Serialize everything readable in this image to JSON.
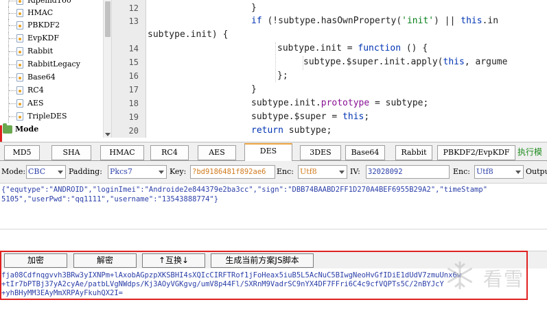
{
  "tree": {
    "items": [
      {
        "label": "Ripemd160"
      },
      {
        "label": "HMAC"
      },
      {
        "label": "PBKDF2"
      },
      {
        "label": "EvpKDF"
      },
      {
        "label": "Rabbit"
      },
      {
        "label": "RabbitLegacy"
      },
      {
        "label": "Base64"
      },
      {
        "label": "RC4"
      },
      {
        "label": "AES"
      },
      {
        "label": "TripleDES"
      }
    ],
    "group": {
      "label": "Mode"
    }
  },
  "editor": {
    "line_numbers": [
      "12",
      "13",
      "14",
      "15",
      "16",
      "17",
      "18",
      "19",
      "20"
    ],
    "lines": {
      "l12": "}",
      "l13_if": "if",
      "l13_a": " (!subtype.hasOwnProperty(",
      "l13_str": "'init'",
      "l13_b": ") || ",
      "l13_this": "this",
      "l13_c": ".in",
      "l13w": "subtype.init) {",
      "l14_a": "subtype.init = ",
      "l14_fn": "function",
      "l14_b": " () {",
      "l15_a": "subtype.$super.init.apply(",
      "l15_this": "this",
      "l15_b": ", argume",
      "l16": "};",
      "l17": "}",
      "l18_a": "subtype.init.",
      "l18_p": "prototype",
      "l18_b": " = subtype;",
      "l19_a": "subtype.$super = ",
      "l19_this": "this",
      "l19_b": ";",
      "l20_kw": "return",
      "l20_b": " subtype;"
    }
  },
  "tabs": [
    {
      "label": "MD5"
    },
    {
      "label": "SHA"
    },
    {
      "label": "HMAC"
    },
    {
      "label": "RC4"
    },
    {
      "label": "AES"
    },
    {
      "label": "DES"
    },
    {
      "label": "3DES"
    },
    {
      "label": "Base64"
    },
    {
      "label": "Rabbit"
    },
    {
      "label": "PBKDF2/EvpKDF"
    },
    {
      "label": "执行模"
    }
  ],
  "options": {
    "mode_label": "Mode:",
    "mode_value": "CBC",
    "padding_label": "Padding:",
    "padding_value": "Pkcs7",
    "key_label": "Key:",
    "key_value": "?bd9186481f892ae6",
    "key_enc_label": "Enc:",
    "key_enc_value": "Utf8",
    "iv_label": "IV:",
    "iv_value": "32028092",
    "iv_enc_label": "Enc:",
    "iv_enc_value": "Utf8",
    "output_label": "Outpu"
  },
  "input_text": {
    "line1": "{\"equtype\":\"ANDROID\",\"loginImei\":\"Androide2e844379e2ba3cc\",\"sign\":\"DBB74BAABD2FF1D270A4BEF6955B29A2\",\"timeStamp\"",
    "line2": "5105\",\"userPwd\":\"qq1111\",\"username\":\"13543888774\"}"
  },
  "buttons": {
    "encrypt": "加密",
    "decrypt": "解密",
    "swap": "↑互换↓",
    "generate": "生成当前方案JS脚本"
  },
  "output_text": {
    "line1": "fja08Cdfnqgvvh3BRw3yIXNPm+lAxobAGpzpXKSBHI4sXQIcCIRFTRof1jFoHeax5iuB5L5AcNuC5BIwgNeoHvGfIDiE1dUdV7zmuUnx6w",
    "line2": "+tIr7bPTBj37yA2cyAe/patbLVgNWdps/Kj3AOyVGKgvg/umV8p44Fl/SXRnM9VadrSC9nYX4DF7FFri6C4c9cfVQPTs5C/2nBYJcY",
    "line3": "+yhBHyMM3EAyMmXRPAyFkuhQX2I="
  },
  "watermark": {
    "text": "看雪"
  }
}
